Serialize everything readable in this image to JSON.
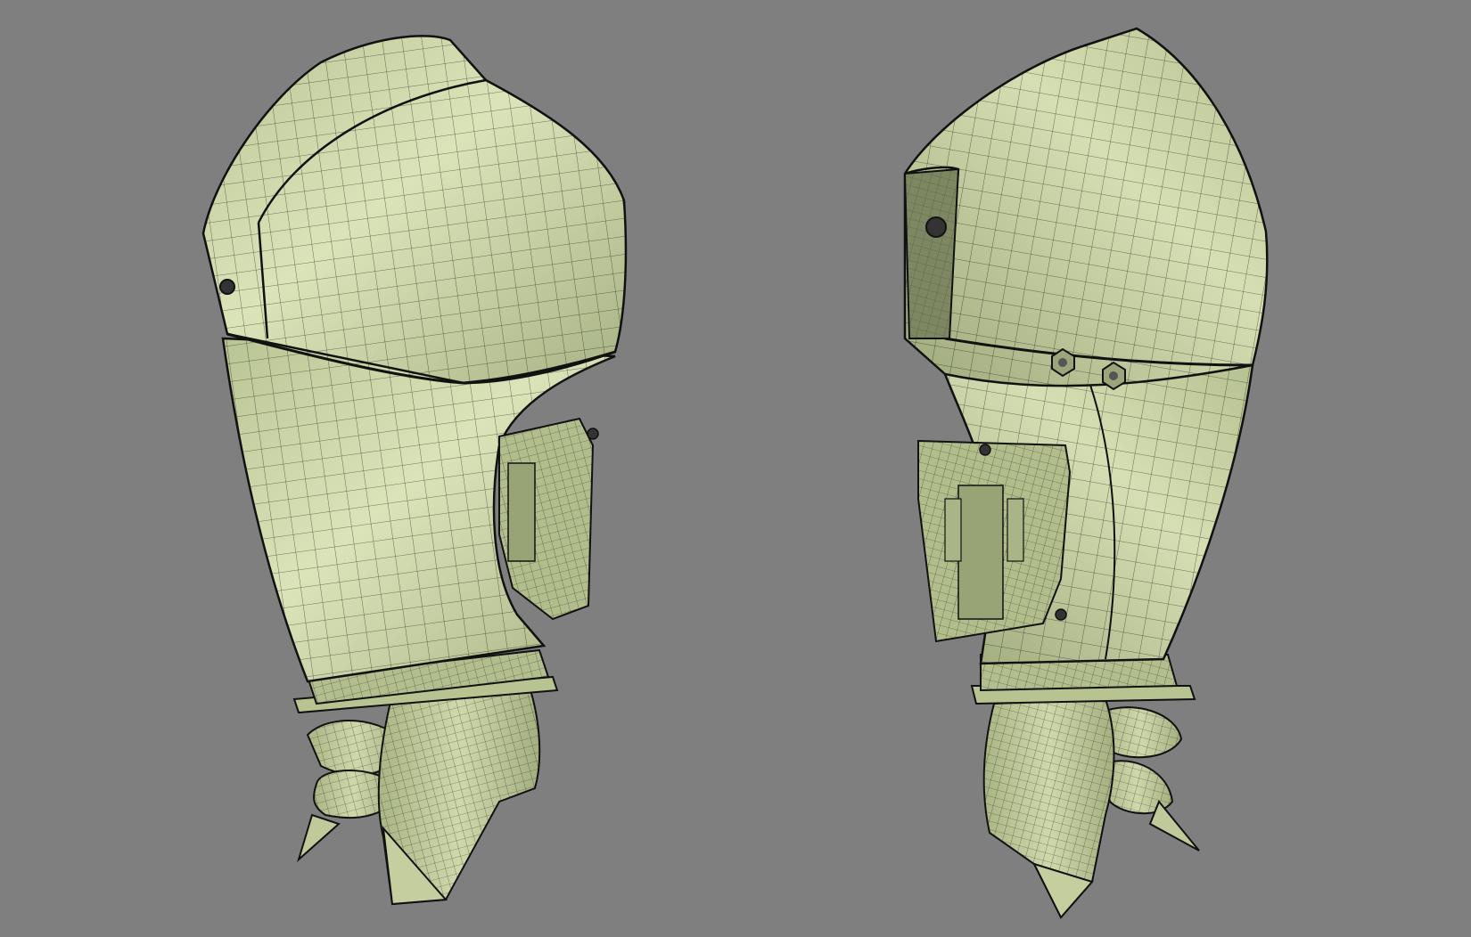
{
  "scene": {
    "background_color": "#7f7f7f",
    "model_fill": "#c9d3a4",
    "model_fill_light": "#dde6bc",
    "model_fill_dark": "#9aa57a",
    "wire_color": "#1a1f14",
    "models": [
      {
        "id": "outboard-motor-left",
        "view": "rear-three-quarter"
      },
      {
        "id": "outboard-motor-right",
        "view": "front-three-quarter"
      }
    ]
  }
}
